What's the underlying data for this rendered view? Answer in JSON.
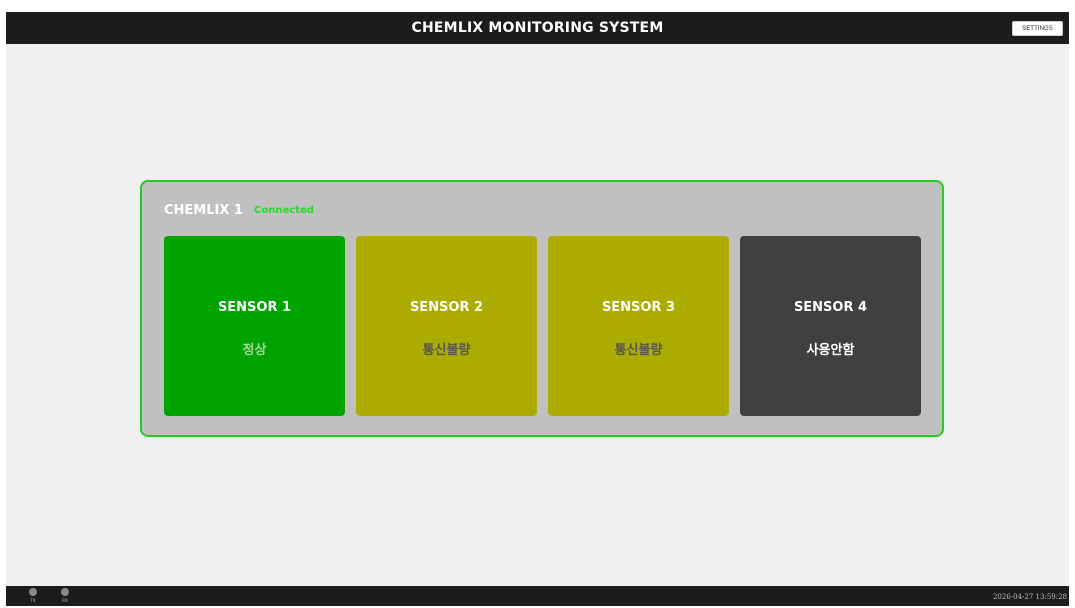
{
  "header": {
    "title": "CHEMLIX MONITORING SYSTEM",
    "settings_label": "SETTINGS"
  },
  "device": {
    "name": "CHEMLIX 1",
    "status": "Connected",
    "border_color": "#22cc22",
    "status_color": "#22dd22",
    "sensors": [
      {
        "label": "SENSOR 1",
        "state": "정상",
        "color": "#00a400",
        "state_color": "#a7d59e"
      },
      {
        "label": "SENSOR 2",
        "state": "통신불량",
        "color": "#acac00",
        "state_color": "#555555"
      },
      {
        "label": "SENSOR 3",
        "state": "통신불량",
        "color": "#acac00",
        "state_color": "#555555"
      },
      {
        "label": "SENSOR 4",
        "state": "사용안함",
        "color": "#404040",
        "state_color": "#ffffff"
      }
    ]
  },
  "footer": {
    "indicators": [
      {
        "label": "TX",
        "icon": "led-indicator-icon"
      },
      {
        "label": "RX",
        "icon": "led-indicator-icon"
      }
    ],
    "datetime": "2026-04-27 13:59:28"
  }
}
